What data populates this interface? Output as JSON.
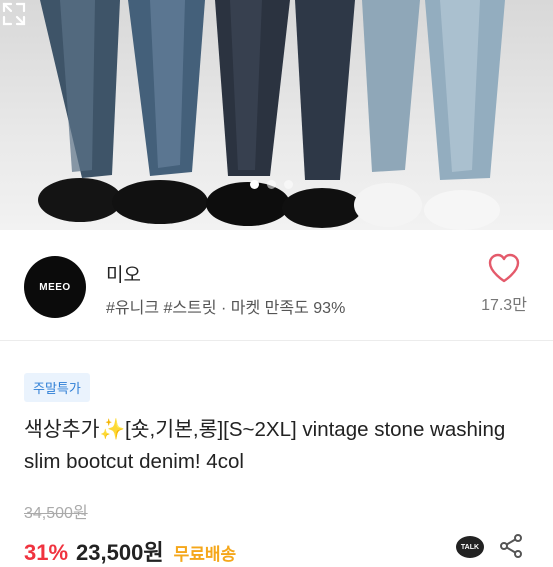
{
  "gallery": {
    "slide_count": 3,
    "active_index": 0,
    "expand_icon": "expand-icon"
  },
  "seller": {
    "avatar_text": "MEEO",
    "name": "미오",
    "meta": "#유니크 #스트릿 · 마켓 만족도 93%",
    "like_count": "17.3만",
    "like_icon": "heart-icon"
  },
  "product": {
    "badge": "주말특가",
    "title": "색상추가✨[숏,기본,롱][S~2XL] vintage stone washing slim bootcut denim! 4col",
    "original_price": "34,500원",
    "discount": "31%",
    "price": "23,500원",
    "shipping": "무료배송"
  },
  "actions": {
    "talk_label": "TALK",
    "share_icon": "share-icon"
  },
  "colors": {
    "discount": "#f0333f",
    "shipping": "#f5a71a",
    "badge_bg": "#eaf3fd",
    "badge_text": "#2f7fd6",
    "heart": "#e45a6b"
  }
}
